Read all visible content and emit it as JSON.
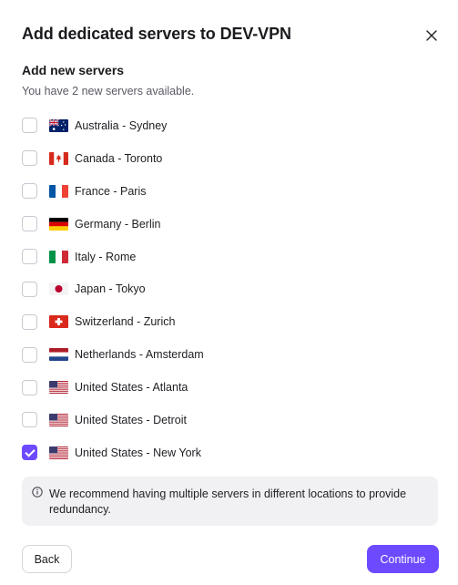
{
  "dialog": {
    "title": "Add dedicated servers to DEV-VPN",
    "close_icon": "close-icon"
  },
  "section": {
    "title": "Add new servers",
    "subtitle": "You have 2 new servers available."
  },
  "servers": [
    {
      "label": "Australia - Sydney",
      "flag": "australia-flag-icon",
      "checked": false
    },
    {
      "label": "Canada - Toronto",
      "flag": "canada-flag-icon",
      "checked": false
    },
    {
      "label": "France - Paris",
      "flag": "france-flag-icon",
      "checked": false
    },
    {
      "label": "Germany - Berlin",
      "flag": "germany-flag-icon",
      "checked": false
    },
    {
      "label": "Italy - Rome",
      "flag": "italy-flag-icon",
      "checked": false
    },
    {
      "label": "Japan - Tokyo",
      "flag": "japan-flag-icon",
      "checked": false
    },
    {
      "label": "Switzerland - Zurich",
      "flag": "switzerland-flag-icon",
      "checked": false
    },
    {
      "label": "Netherlands - Amsterdam",
      "flag": "netherlands-flag-icon",
      "checked": false
    },
    {
      "label": "United States - Atlanta",
      "flag": "united-states-flag-icon",
      "checked": false
    },
    {
      "label": "United States - Detroit",
      "flag": "united-states-flag-icon",
      "checked": false
    },
    {
      "label": "United States - New York",
      "flag": "united-states-flag-icon",
      "checked": true
    }
  ],
  "note": {
    "icon": "info-icon",
    "text": "We recommend having multiple servers in different locations to provide redundancy."
  },
  "footer": {
    "back_label": "Back",
    "continue_label": "Continue"
  },
  "colors": {
    "accent": "#6d4aff",
    "note_background": "#f1f1f3"
  }
}
